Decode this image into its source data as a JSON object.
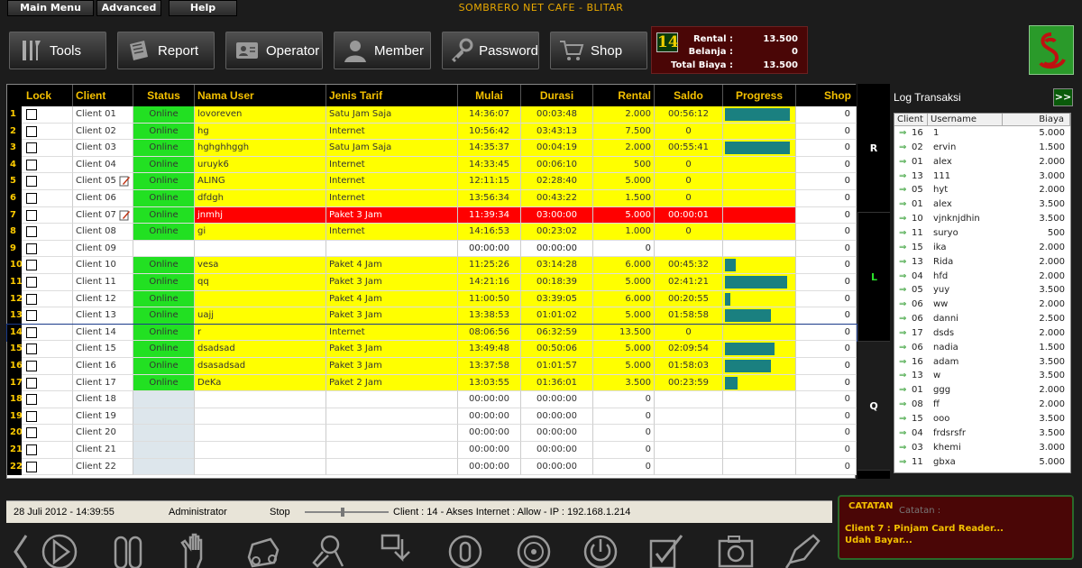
{
  "menu": {
    "main_menu": "Main Menu",
    "advanced": "Advanced",
    "help": "Help"
  },
  "title": "SOMBRERO NET CAFE - BLITAR",
  "toolbar": [
    {
      "label": "Tools",
      "icon": "tools-icon"
    },
    {
      "label": "Report",
      "icon": "report-icon"
    },
    {
      "label": "Operator",
      "icon": "operator-icon"
    },
    {
      "label": "Member",
      "icon": "member-icon"
    },
    {
      "label": "Password",
      "icon": "key-icon"
    },
    {
      "label": "Shop",
      "icon": "cart-icon"
    }
  ],
  "summary": {
    "counter": "14",
    "rental_label": "Rental :",
    "rental_value": "13.500",
    "belanja_label": "Belanja :",
    "belanja_value": "0",
    "total_label": "Total Biaya :",
    "total_value": "13.500"
  },
  "table": {
    "headers": [
      "Lock",
      "Client",
      "Status",
      "Nama User",
      "Jenis Tarif",
      "Mulai",
      "Durasi",
      "Rental",
      "Saldo",
      "Progress",
      "Shop"
    ],
    "rows": [
      {
        "n": "1",
        "client": "Client 01",
        "status": "Online",
        "user": "lovoreven",
        "tarif": "Satu Jam Saja",
        "mulai": "14:36:07",
        "durasi": "00:03:48",
        "rental": "2.000",
        "saldo": "00:56:12",
        "progress": 0.94,
        "shop": "0",
        "state": "active",
        "note": false
      },
      {
        "n": "2",
        "client": "Client 02",
        "status": "Online",
        "user": "hg",
        "tarif": "Internet",
        "mulai": "10:56:42",
        "durasi": "03:43:13",
        "rental": "7.500",
        "saldo": "0",
        "progress": 0,
        "shop": "0",
        "state": "active",
        "note": false
      },
      {
        "n": "3",
        "client": "Client 03",
        "status": "Online",
        "user": "hghghhggh",
        "tarif": "Satu Jam Saja",
        "mulai": "14:35:37",
        "durasi": "00:04:19",
        "rental": "2.000",
        "saldo": "00:55:41",
        "progress": 0.93,
        "shop": "0",
        "state": "active",
        "note": false
      },
      {
        "n": "4",
        "client": "Client 04",
        "status": "Online",
        "user": "uruyk6",
        "tarif": "Internet",
        "mulai": "14:33:45",
        "durasi": "00:06:10",
        "rental": "500",
        "saldo": "0",
        "progress": 0,
        "shop": "0",
        "state": "active",
        "note": false
      },
      {
        "n": "5",
        "client": "Client 05",
        "status": "Online",
        "user": "ALING",
        "tarif": "Internet",
        "mulai": "12:11:15",
        "durasi": "02:28:40",
        "rental": "5.000",
        "saldo": "0",
        "progress": 0,
        "shop": "0",
        "state": "active",
        "note": true
      },
      {
        "n": "6",
        "client": "Client 06",
        "status": "Online",
        "user": "dfdgh",
        "tarif": "Internet",
        "mulai": "13:56:34",
        "durasi": "00:43:22",
        "rental": "1.500",
        "saldo": "0",
        "progress": 0,
        "shop": "0",
        "state": "active",
        "note": false
      },
      {
        "n": "7",
        "client": "Client 07",
        "status": "Online",
        "user": "jnmhj",
        "tarif": "Paket 3 Jam",
        "mulai": "11:39:34",
        "durasi": "03:00:00",
        "rental": "5.000",
        "saldo": "00:00:01",
        "progress": 0,
        "shop": "0",
        "state": "expired",
        "note": true
      },
      {
        "n": "8",
        "client": "Client 08",
        "status": "Online",
        "user": "gi",
        "tarif": "Internet",
        "mulai": "14:16:53",
        "durasi": "00:23:02",
        "rental": "1.000",
        "saldo": "0",
        "progress": 0,
        "shop": "0",
        "state": "active",
        "note": false
      },
      {
        "n": "9",
        "client": "Client 09",
        "status": "",
        "user": "",
        "tarif": "",
        "mulai": "00:00:00",
        "durasi": "00:00:00",
        "rental": "0",
        "saldo": "",
        "progress": 0,
        "shop": "0",
        "state": "idle",
        "note": false
      },
      {
        "n": "10",
        "client": "Client 10",
        "status": "Online",
        "user": "vesa",
        "tarif": "Paket 4 Jam",
        "mulai": "11:25:26",
        "durasi": "03:14:28",
        "rental": "6.000",
        "saldo": "00:45:32",
        "progress": 0.16,
        "shop": "0",
        "state": "active",
        "note": false
      },
      {
        "n": "11",
        "client": "Client 11",
        "status": "Online",
        "user": "qq",
        "tarif": "Paket 3 Jam",
        "mulai": "14:21:16",
        "durasi": "00:18:39",
        "rental": "5.000",
        "saldo": "02:41:21",
        "progress": 0.9,
        "shop": "0",
        "state": "active",
        "note": false
      },
      {
        "n": "12",
        "client": "Client 12",
        "status": "Online",
        "user": "",
        "tarif": "Paket 4 Jam",
        "mulai": "11:00:50",
        "durasi": "03:39:05",
        "rental": "6.000",
        "saldo": "00:20:55",
        "progress": 0.08,
        "shop": "0",
        "state": "active",
        "note": false
      },
      {
        "n": "13",
        "client": "Client 13",
        "status": "Online",
        "user": "uajj",
        "tarif": "Paket 3 Jam",
        "mulai": "13:38:53",
        "durasi": "01:01:02",
        "rental": "5.000",
        "saldo": "01:58:58",
        "progress": 0.66,
        "shop": "0",
        "state": "active",
        "note": false
      },
      {
        "n": "14",
        "client": "Client 14",
        "status": "Online",
        "user": "r",
        "tarif": "Internet",
        "mulai": "08:06:56",
        "durasi": "06:32:59",
        "rental": "13.500",
        "saldo": "0",
        "progress": 0,
        "shop": "0",
        "state": "selected",
        "note": false
      },
      {
        "n": "15",
        "client": "Client 15",
        "status": "Online",
        "user": "dsadsad",
        "tarif": "Paket 3 Jam",
        "mulai": "13:49:48",
        "durasi": "00:50:06",
        "rental": "5.000",
        "saldo": "02:09:54",
        "progress": 0.72,
        "shop": "0",
        "state": "active",
        "note": false
      },
      {
        "n": "16",
        "client": "Client 16",
        "status": "Online",
        "user": "dsasadsad",
        "tarif": "Paket 3 Jam",
        "mulai": "13:37:58",
        "durasi": "01:01:57",
        "rental": "5.000",
        "saldo": "01:58:03",
        "progress": 0.66,
        "shop": "0",
        "state": "active",
        "note": false
      },
      {
        "n": "17",
        "client": "Client 17",
        "status": "Online",
        "user": "DeKa",
        "tarif": "Paket 2 Jam",
        "mulai": "13:03:55",
        "durasi": "01:36:01",
        "rental": "3.500",
        "saldo": "00:23:59",
        "progress": 0.18,
        "shop": "0",
        "state": "active",
        "note": false
      },
      {
        "n": "18",
        "client": "Client 18",
        "status": "",
        "user": "",
        "tarif": "",
        "mulai": "00:00:00",
        "durasi": "00:00:00",
        "rental": "0",
        "saldo": "",
        "progress": 0,
        "shop": "0",
        "state": "off",
        "note": false
      },
      {
        "n": "19",
        "client": "Client 19",
        "status": "",
        "user": "",
        "tarif": "",
        "mulai": "00:00:00",
        "durasi": "00:00:00",
        "rental": "0",
        "saldo": "",
        "progress": 0,
        "shop": "0",
        "state": "off",
        "note": false
      },
      {
        "n": "20",
        "client": "Client 20",
        "status": "",
        "user": "",
        "tarif": "",
        "mulai": "00:00:00",
        "durasi": "00:00:00",
        "rental": "0",
        "saldo": "",
        "progress": 0,
        "shop": "0",
        "state": "off",
        "note": false
      },
      {
        "n": "21",
        "client": "Client 21",
        "status": "",
        "user": "",
        "tarif": "",
        "mulai": "00:00:00",
        "durasi": "00:00:00",
        "rental": "0",
        "saldo": "",
        "progress": 0,
        "shop": "0",
        "state": "off",
        "note": false
      },
      {
        "n": "22",
        "client": "Client 22",
        "status": "",
        "user": "",
        "tarif": "",
        "mulai": "00:00:00",
        "durasi": "00:00:00",
        "rental": "0",
        "saldo": "",
        "progress": 0,
        "shop": "0",
        "state": "off",
        "note": false
      }
    ]
  },
  "side_tabs": [
    "R",
    "L",
    "Q"
  ],
  "log": {
    "title": "Log Transaksi",
    "expand": ">>",
    "headers": [
      "Client",
      "Username",
      "Biaya"
    ],
    "rows": [
      {
        "c": "16",
        "u": "1",
        "b": "5.000"
      },
      {
        "c": "02",
        "u": "ervin",
        "b": "1.500"
      },
      {
        "c": "01",
        "u": "alex",
        "b": "2.000"
      },
      {
        "c": "13",
        "u": "111",
        "b": "3.000"
      },
      {
        "c": "05",
        "u": "hyt",
        "b": "2.000"
      },
      {
        "c": "01",
        "u": "alex",
        "b": "3.500"
      },
      {
        "c": "10",
        "u": "vjnknjdhin",
        "b": "3.500"
      },
      {
        "c": "11",
        "u": "suryo",
        "b": "500"
      },
      {
        "c": "15",
        "u": "ika",
        "b": "2.000"
      },
      {
        "c": "13",
        "u": "Rida",
        "b": "2.000"
      },
      {
        "c": "04",
        "u": "hfd",
        "b": "2.000"
      },
      {
        "c": "05",
        "u": "yuy",
        "b": "3.500"
      },
      {
        "c": "06",
        "u": "ww",
        "b": "2.000"
      },
      {
        "c": "06",
        "u": "danni",
        "b": "2.500"
      },
      {
        "c": "17",
        "u": "dsds",
        "b": "2.000"
      },
      {
        "c": "06",
        "u": "nadia",
        "b": "1.500"
      },
      {
        "c": "16",
        "u": "adam",
        "b": "3.500"
      },
      {
        "c": "13",
        "u": "w",
        "b": "3.500"
      },
      {
        "c": "01",
        "u": "ggg",
        "b": "2.000"
      },
      {
        "c": "08",
        "u": "ff",
        "b": "2.000"
      },
      {
        "c": "15",
        "u": "ooo",
        "b": "3.500"
      },
      {
        "c": "04",
        "u": "frdsrsfr",
        "b": "3.500"
      },
      {
        "c": "03",
        "u": "khemi",
        "b": "3.000"
      },
      {
        "c": "11",
        "u": "gbxa",
        "b": "5.000"
      }
    ]
  },
  "status": {
    "datetime": "28 Juli 2012  -  14:39:55",
    "user": "Administrator",
    "mode": "Stop",
    "info": "Client : 14 - Akses Internet : Allow - IP : 192.168.1.214"
  },
  "catatan": {
    "label": "CATATAN",
    "ghost": "Catatan :",
    "line1": "Client 7 : Pinjam Card Reader...",
    "line2": "Udah Bayar..."
  },
  "bottom_icons": [
    "back-icon",
    "play-icon",
    "pause-icon",
    "hand-icon",
    "car-icon",
    "tool-icon",
    "download-icon",
    "pause-circle-icon",
    "disc-icon",
    "power-icon",
    "check-icon",
    "camera-icon",
    "pen-icon"
  ],
  "colors": {
    "online": "#22e022",
    "active_row": "#ffff00",
    "expired_row": "#ff0000",
    "progress": "#1a8080",
    "header_text": "#f4c000"
  }
}
